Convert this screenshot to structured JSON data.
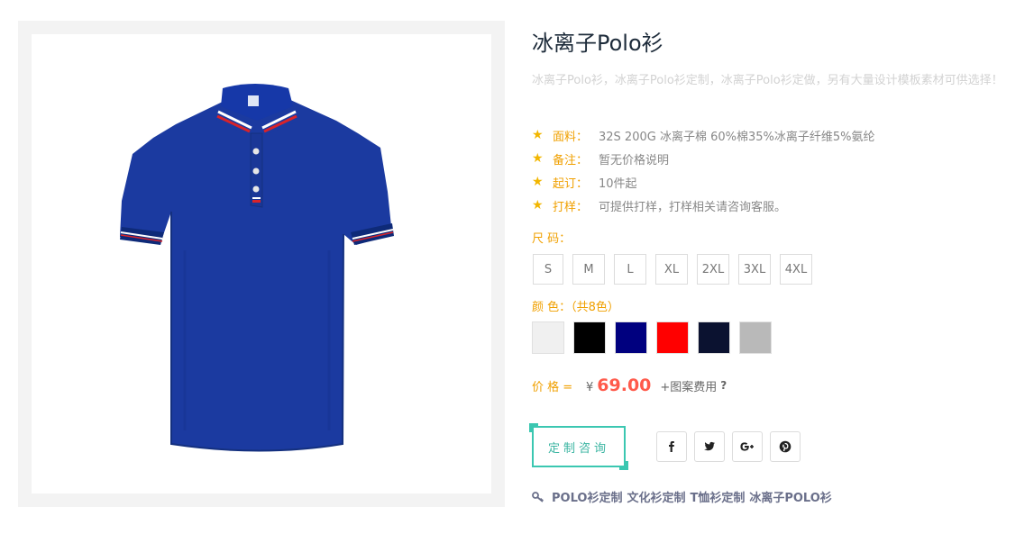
{
  "product": {
    "title": "冰离子Polo衫",
    "description": "冰离子Polo衫，冰离子Polo衫定制，冰离子Polo衫定做，另有大量设计模板素材可供选择！",
    "image_icon": "polo-shirt-image"
  },
  "specs": [
    {
      "label": "面料：",
      "value": "32S 200G 冰离子棉 60%棉35%冰离子纤维5%氨纶"
    },
    {
      "label": "备注：",
      "value": "暂无价格说明"
    },
    {
      "label": "起订：",
      "value": "10件起"
    },
    {
      "label": "打样：",
      "value": "可提供打样，打样相关请咨询客服。"
    }
  ],
  "size_section": {
    "label": "尺 码：",
    "options": [
      "S",
      "M",
      "L",
      "XL",
      "2XL",
      "3XL",
      "4XL"
    ]
  },
  "color_section": {
    "label": "颜 色：（共8色）",
    "swatches": [
      "#f0f0f0",
      "#000000",
      "#00007f",
      "#ff0000",
      "#0b1230",
      "#b9b9b9"
    ]
  },
  "price": {
    "label": "价 格 =",
    "currency": "¥",
    "amount": "69.00",
    "extra": "+图案费用",
    "help": "?"
  },
  "actions": {
    "consult_label": "定制咨询"
  },
  "socials": [
    "facebook-icon",
    "twitter-icon",
    "google-plus-icon",
    "pinterest-icon"
  ],
  "tags": [
    "POLO衫定制",
    "文化衫定制",
    "T恤衫定制",
    "冰离子POLO衫"
  ],
  "colors": {
    "accent_orange": "#f0a000",
    "price_red": "#ff5a4b",
    "teal": "#3bc7b1",
    "star": "#f2b600"
  }
}
